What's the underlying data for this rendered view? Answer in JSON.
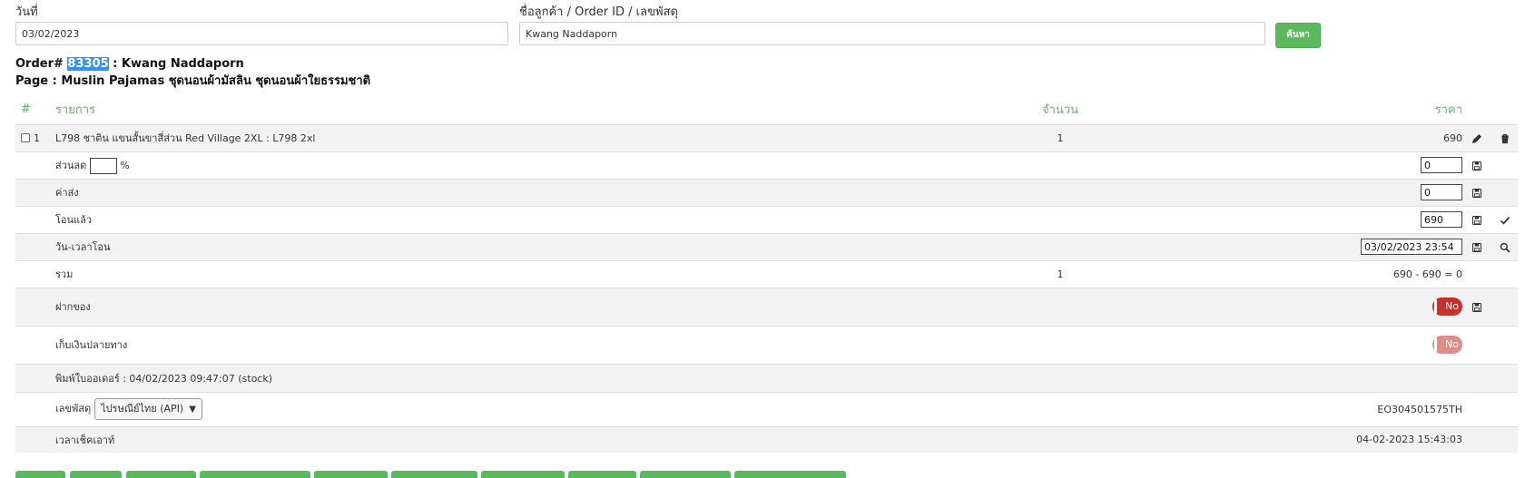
{
  "search": {
    "date_label": "วันที่",
    "date_value": "03/02/2023",
    "customer_label": "ชื่อลูกค้า / Order ID / เลขพัสดุ",
    "customer_value": "Kwang Naddaporn",
    "search_button": "ค้นหา"
  },
  "order": {
    "prefix": "Order# ",
    "id": "83305",
    "customer_sep": " : Kwang Naddaporn",
    "page_line": "Page : Muslin Pajamas ชุดนอนผ้ามัสลิน ชุดนอนผ้าใยธรรมชาติ"
  },
  "table": {
    "headers": {
      "hash": "#",
      "item": "รายการ",
      "qty": "จำนวน",
      "price": "ราคา"
    },
    "line_item": {
      "no": "1",
      "name": "L798 ชาติน แขนสั้นขาสี่ส่วน Red Village 2XL : L798 2xl",
      "qty": "1",
      "price": "690"
    },
    "discount": {
      "label": "ส่วนลด",
      "percent_value": "",
      "percent_sign": "%",
      "value": "0"
    },
    "shipping": {
      "label": "ค่าส่ง",
      "value": "0"
    },
    "transferred": {
      "label": "โอนแล้ว",
      "value": "690"
    },
    "transfer_time": {
      "label": "วัน-เวลาโอน",
      "value": "03/02/2023 23:54"
    },
    "total": {
      "label": "รวม",
      "qty": "1",
      "value": "690 - 690 = 0"
    },
    "deposit": {
      "label": "ฝากของ",
      "toggle": "No"
    },
    "cod": {
      "label": "เก็บเงินปลายทาง",
      "toggle": "No"
    },
    "printed": {
      "text": "พิมพ์ใบออเดอร์ : 04/02/2023 09:47:07 (stock)"
    },
    "tracking": {
      "label": "เลขพัสดุ",
      "carrier": "ไปรษณีย์ไทย (API)",
      "number": "EO304501575TH"
    },
    "checkout": {
      "label": "เวลาเช็คเอาท์",
      "value": "04-02-2023 15:43:03"
    }
  },
  "icons": {
    "edit": "pencil-icon",
    "delete": "trash-icon",
    "save": "floppy-disk-icon",
    "confirm": "check-icon",
    "search": "search-icon"
  },
  "colors": {
    "accent": "#5cb85c",
    "selection": "#3390ff",
    "toggle_no": "#c9302c",
    "tracking": "#2e7d32"
  }
}
